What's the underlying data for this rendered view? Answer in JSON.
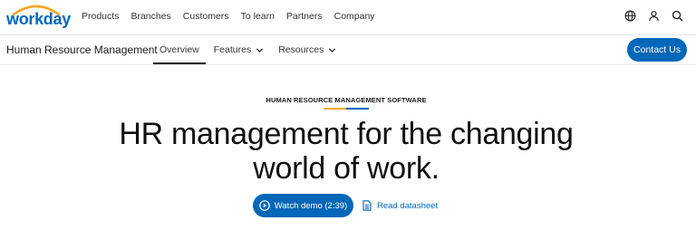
{
  "brand": {
    "logo_text": "workday",
    "logo_dot": "."
  },
  "top_nav": {
    "items": [
      "Products",
      "Branches",
      "Customers",
      "To learn",
      "Partners",
      "Company"
    ],
    "icons": [
      "globe-icon",
      "user-icon",
      "search-icon"
    ]
  },
  "sub_nav": {
    "title": "Human Resource Management",
    "items": [
      {
        "label": "Overview",
        "active": true,
        "dropdown": false
      },
      {
        "label": "Features",
        "active": false,
        "dropdown": true
      },
      {
        "label": "Resources",
        "active": false,
        "dropdown": true
      }
    ],
    "contact_label": "Contact Us"
  },
  "hero": {
    "eyebrow": "HUMAN RESOURCE MANAGEMENT SOFTWARE",
    "headline_line1": "HR management for the changing",
    "headline_line2": "world of work.",
    "demo_label": "Watch demo (2:39)",
    "datasheet_label": "Read datasheet"
  },
  "colors": {
    "brand_blue": "#0067b9",
    "accent_orange": "#f5a623"
  }
}
